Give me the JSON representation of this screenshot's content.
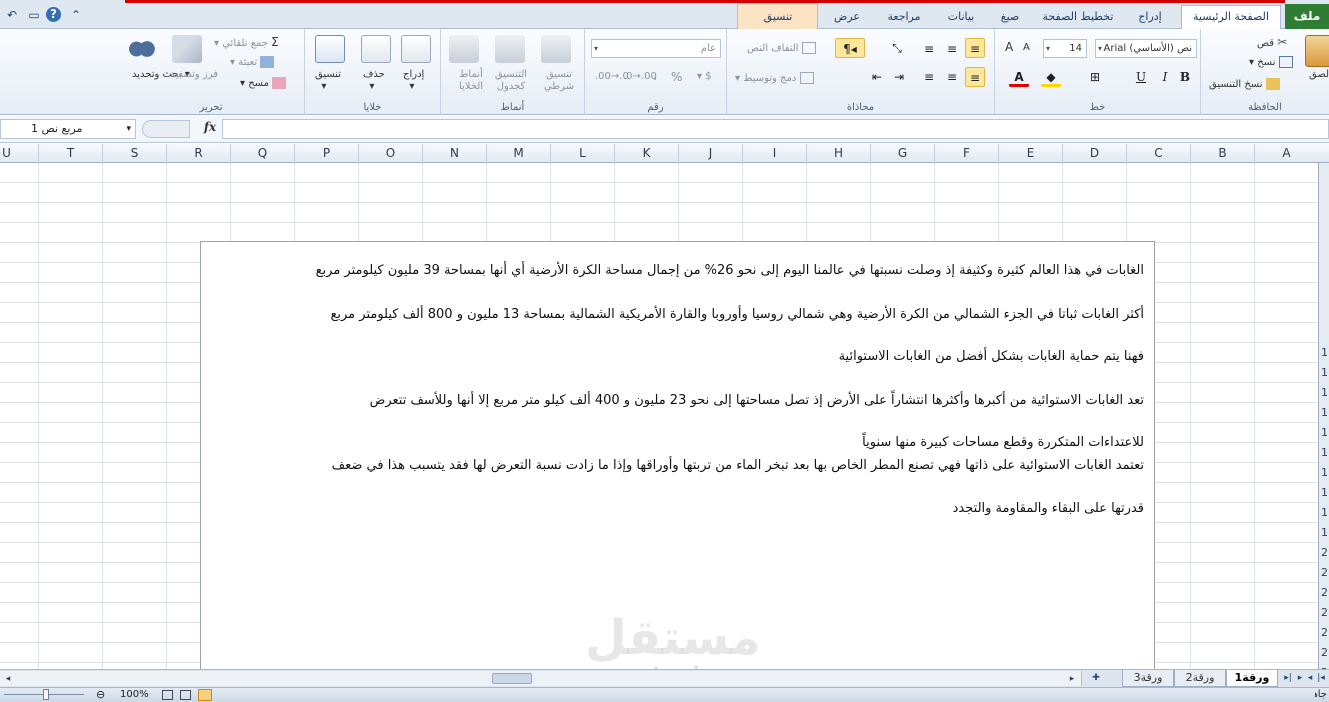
{
  "tabs": {
    "file": "ملف",
    "home": "الصفحة الرئيسية",
    "insert": "إدراج",
    "page_layout": "تخطيط الصفحة",
    "formulas": "صيغ",
    "data": "بيانات",
    "review": "مراجعة",
    "view": "عرض",
    "format": "تنسيق"
  },
  "ribbon": {
    "clipboard": {
      "label": "الحافظة",
      "paste": "لصق",
      "cut": "قص",
      "copy": "نسخ",
      "format_painter": "نسخ التنسيق"
    },
    "font": {
      "label": "خط",
      "font_name": "Arial (الأساسي) نص",
      "font_size": "14",
      "bold": "B",
      "italic": "I",
      "underline": "U",
      "grow": "A",
      "shrink": "A"
    },
    "alignment": {
      "label": "محاذاة",
      "wrap_text": "التفاف النص",
      "merge_center": "دمج وتوسيط"
    },
    "number": {
      "label": "رقم",
      "format": "عام",
      "percent": "%",
      "comma": "،"
    },
    "styles": {
      "label": "أنماط",
      "conditional": "تنسيق شرطي",
      "as_table": "التنسيق كجدول",
      "cell_styles": "أنماط الخلايا"
    },
    "cells": {
      "label": "خلايا",
      "insert": "إدراج",
      "delete": "حذف",
      "format": "تنسيق"
    },
    "editing": {
      "label": "تحرير",
      "autosum": "جمع تلقائي",
      "fill": "تعبئة",
      "clear": "مسح",
      "sort_filter": "فرز وتصفية",
      "find_select": "بحث وتحديد"
    }
  },
  "formula_bar": {
    "name_box": "مربع نص 1",
    "fx": "fx",
    "value": ""
  },
  "columns": [
    "A",
    "B",
    "C",
    "D",
    "E",
    "F",
    "G",
    "H",
    "I",
    "J",
    "K",
    "L",
    "M",
    "N",
    "O",
    "P",
    "Q",
    "R",
    "S",
    "T",
    "U"
  ],
  "textbox": {
    "lines": [
      "الغابات في هذا العالم كثيرة وكثيفة إذ وصلت نسبتها في عالمنا اليوم إلى نحو 26% من إجمال مساحة الكرة الأرضية أي أنها بمساحة 39 مليون كيلومتر مربع",
      "أكثر الغابات ثباتا في الجزء الشمالي من الكرة الأرضية وهي شمالي روسيا وأوروبا والقارة الأمريكية الشمالية بمساحة 13 مليون و 800 ألف كيلومتر مربع",
      "فهنا يتم حماية الغابات بشكل أفضل من الغابات الاستوائية",
      "تعد الغابات الاستوائية من أكبرها وأكثرها انتشاراً على الأرض إذ تصل مساحتها إلى نحو 23 مليون و 400 ألف كيلو متر مربع إلا أنها وللأسف تتعرض",
      "للاعتداءات المتكررة وقطع مساحات كبيرة منها سنوياً",
      "تعتمد الغابات الاستوائية على ذاتها فهي تصنع المطر الخاص بها بعد تبخر الماء من تربتها وأوراقها وإذا ما زادت نسبة التعرض لها فقد يتسبب هذا في ضعف",
      "قدرتها على البقاء والمقاومة والتجدد"
    ]
  },
  "sheets": [
    "ورقة1",
    "ورقة2",
    "ورقة3"
  ],
  "status": {
    "ready": "جاهز",
    "zoom": "100%"
  },
  "watermark": {
    "arabic": "مستقل",
    "latin": "mostaql.com"
  }
}
